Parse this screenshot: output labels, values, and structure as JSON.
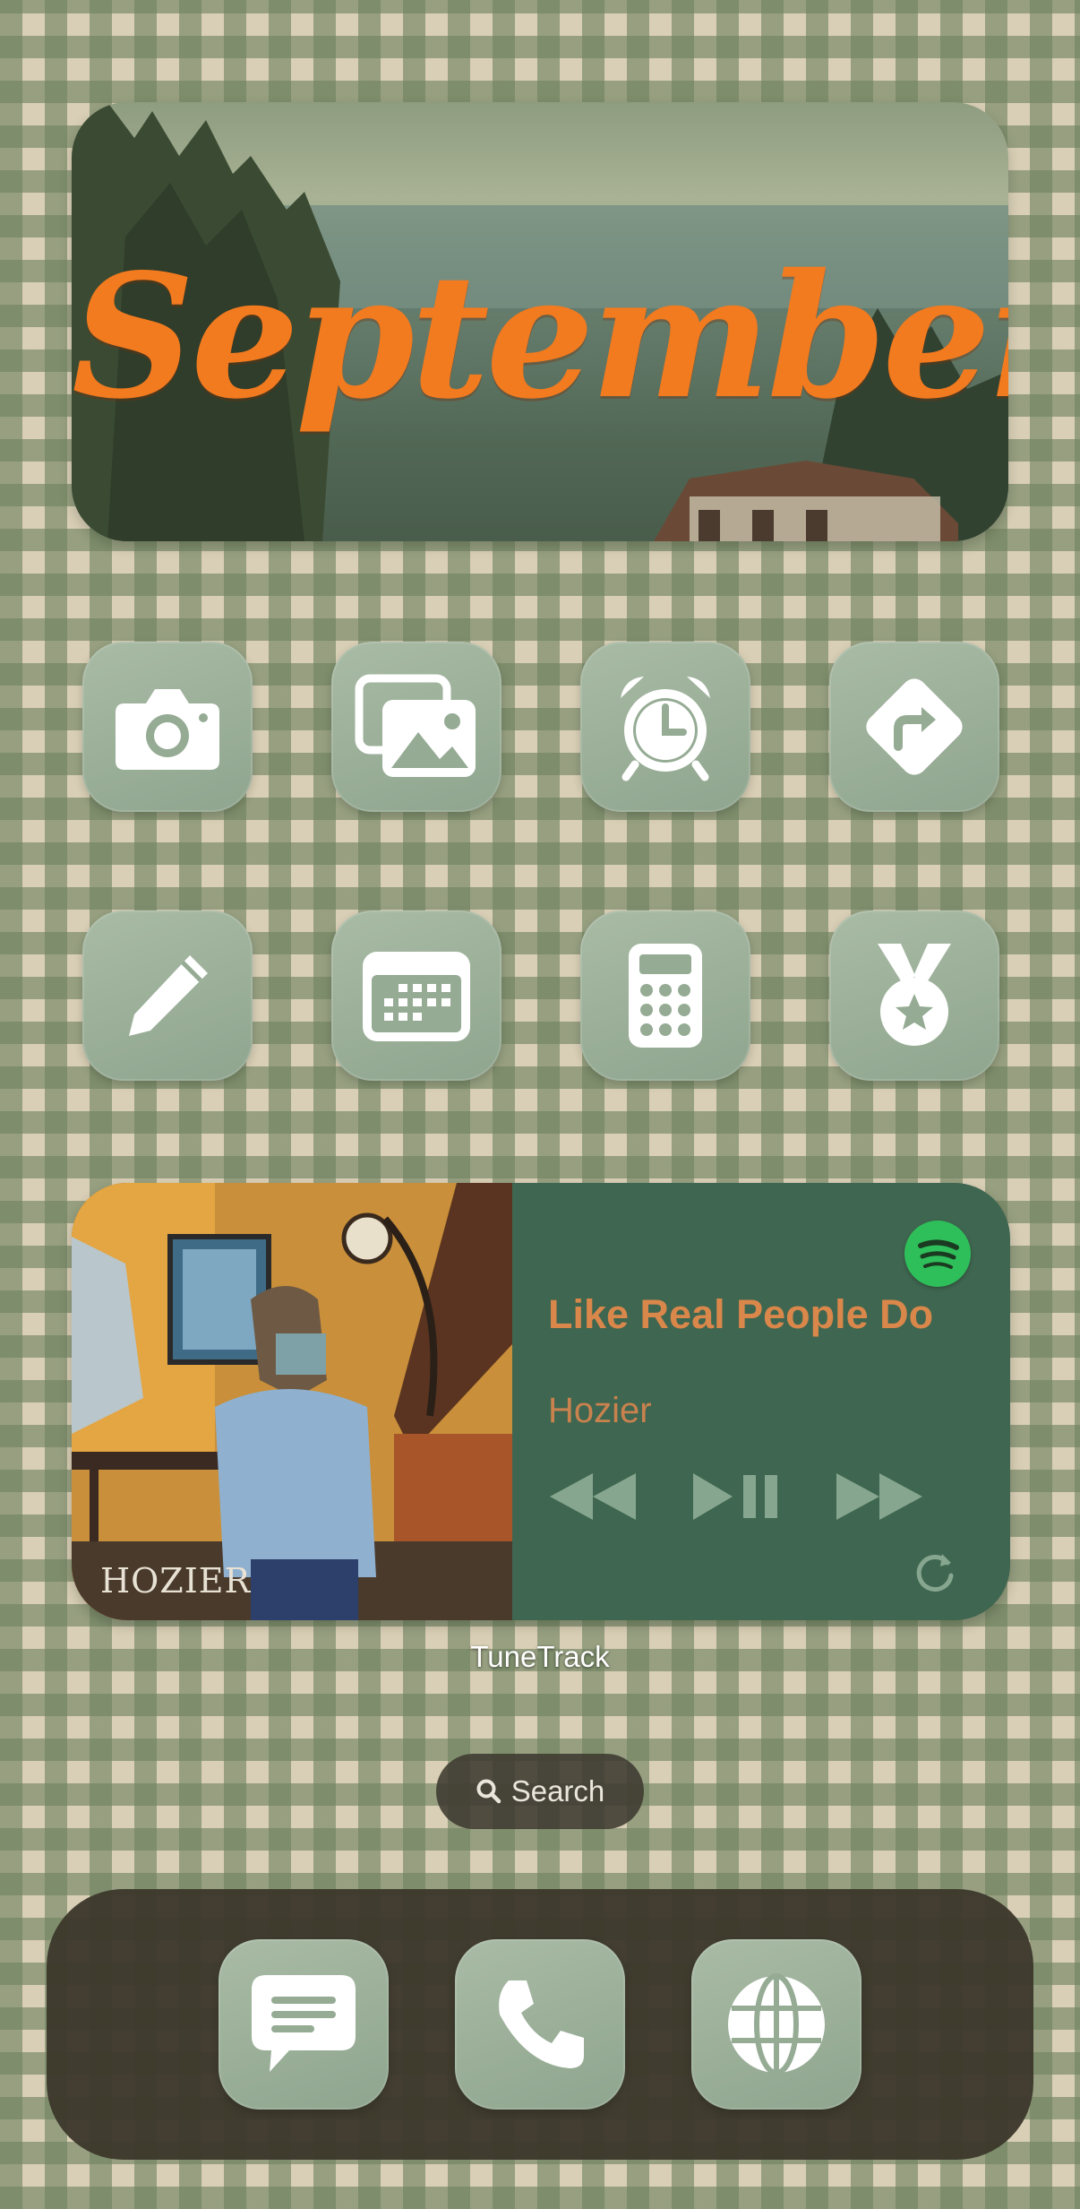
{
  "banner": {
    "title": "September"
  },
  "apps": [
    {
      "name": "camera",
      "icon": "camera-icon"
    },
    {
      "name": "photos",
      "icon": "photos-icon"
    },
    {
      "name": "clock",
      "icon": "alarm-clock-icon"
    },
    {
      "name": "maps",
      "icon": "directions-icon"
    },
    {
      "name": "notes",
      "icon": "pencil-icon"
    },
    {
      "name": "calendar",
      "icon": "calendar-icon"
    },
    {
      "name": "calculator",
      "icon": "calculator-icon"
    },
    {
      "name": "achievements",
      "icon": "medal-icon"
    }
  ],
  "music": {
    "album_text": "HOZIER",
    "title": "Like Real People Do",
    "artist": "Hozier",
    "service_icon": "spotify-icon",
    "controls": [
      "rewind-icon",
      "play-pause-icon",
      "fast-forward-icon"
    ],
    "refresh_icon": "refresh-icon"
  },
  "widget_label": "TuneTrack",
  "search": {
    "label": "Search",
    "icon": "search-icon"
  },
  "dock": [
    {
      "name": "messages",
      "icon": "message-icon"
    },
    {
      "name": "phone",
      "icon": "phone-icon"
    },
    {
      "name": "browser",
      "icon": "globe-icon"
    }
  ],
  "colors": {
    "icon_tile": "#98ad96",
    "banner_text": "#f27a1f",
    "music_bg": "#3f6650",
    "song_text": "#d9874a",
    "spotify": "#2fbf5a",
    "dock_bg": "#3c382c"
  }
}
